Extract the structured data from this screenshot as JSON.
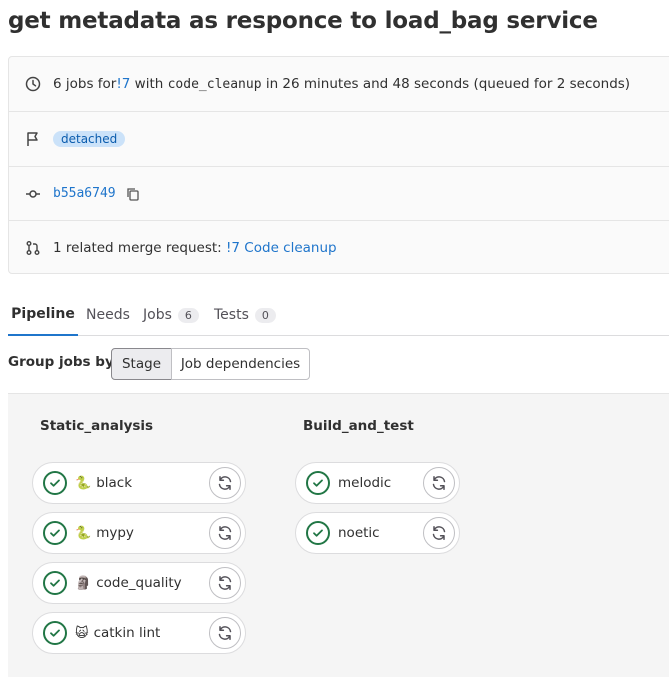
{
  "page": {
    "title": "get metadata as responce to load_bag service"
  },
  "info": {
    "pipeline_summary": {
      "prefix": "6 jobs for ",
      "mr_ref": "!7",
      "with": " with ",
      "branch": "code_cleanup",
      "duration": " in 26 minutes and 48 seconds (queued for 2 seconds)"
    },
    "badge": "detached",
    "commit_sha": "b55a6749",
    "merge_request": {
      "prefix": "1 related merge request: ",
      "link": "!7 Code cleanup"
    }
  },
  "tabs": [
    {
      "label": "Pipeline",
      "active": true
    },
    {
      "label": "Needs"
    },
    {
      "label": "Jobs",
      "count": "6"
    },
    {
      "label": "Tests",
      "count": "0"
    }
  ],
  "grouping": {
    "label": "Group jobs by",
    "options": [
      "Stage",
      "Job dependencies"
    ],
    "selected": "Stage"
  },
  "stages": [
    {
      "name": "Static_analysis",
      "jobs": [
        {
          "emoji": "🐍",
          "name": "black",
          "status": "success"
        },
        {
          "emoji": "🐍",
          "name": "mypy",
          "status": "success"
        },
        {
          "emoji": "🗿",
          "name": "code_quality",
          "status": "success"
        },
        {
          "emoji": "🙀",
          "name": "catkin lint",
          "status": "success"
        }
      ]
    },
    {
      "name": "Build_and_test",
      "jobs": [
        {
          "emoji": "",
          "name": "melodic",
          "status": "success"
        },
        {
          "emoji": "",
          "name": "noetic",
          "status": "success"
        }
      ]
    }
  ],
  "colors": {
    "link": "#1f75cb",
    "success": "#217645",
    "badge_bg": "#cbe2f9",
    "badge_text": "#0b5cad"
  },
  "icons": [
    "clock-icon",
    "flag-icon",
    "commit-icon",
    "copy-icon",
    "merge-request-icon",
    "check-circle-icon",
    "retry-icon"
  ]
}
